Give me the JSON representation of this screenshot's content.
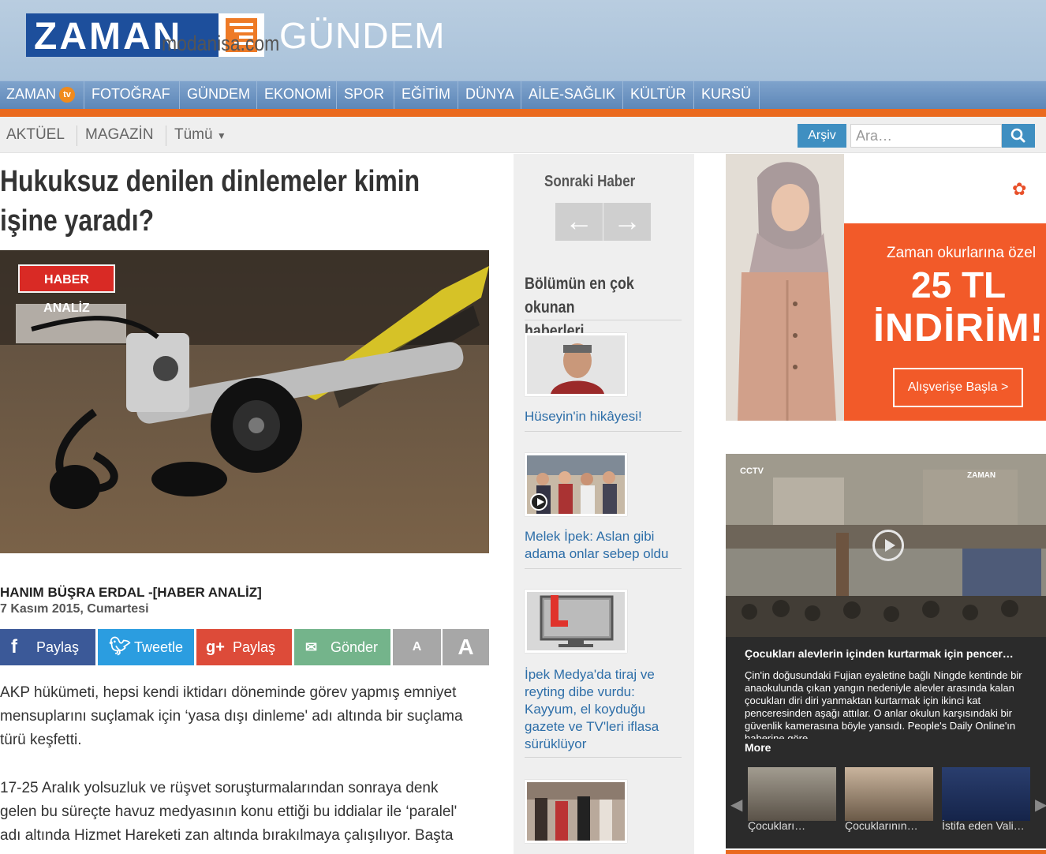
{
  "brand": {
    "logo": "ZAMAN",
    "section": "GÜNDEM"
  },
  "nav": {
    "items": [
      "ZAMAN",
      "FOTOĞRAF",
      "GÜNDEM",
      "EKONOMİ",
      "SPOR",
      "EĞİTİM",
      "DÜNYA",
      "AİLE-SAĞLIK",
      "KÜLTÜR",
      "KURSÜ"
    ],
    "tv_badge": "tv"
  },
  "subnav": {
    "items": [
      "AKTÜEL",
      "MAGAZİN",
      "Tümü"
    ],
    "archive": "Arşiv",
    "search_placeholder": "Ara…"
  },
  "article": {
    "title_line1": "Hukuksuz denilen dinlemeler kimin",
    "title_line2": "işine yaradı?",
    "badge": "HABER ANALİZ",
    "author": "HANIM BÜŞRA ERDAL -[HABER ANALİZ]",
    "date": "7 Kasım 2015, Cumartesi",
    "share": {
      "facebook": "Paylaş",
      "twitter": "Tweetle",
      "google": "Paylaş",
      "email": "Gönder",
      "font_small": "A",
      "font_large": "A"
    },
    "p1": [
      "AKP hükümeti, hepsi kendi iktidarı döneminde görev yapmış emniyet",
      "mensuplarını suçlamak için ‘yasa dışı dinleme' adı altında bir suçlama",
      "türü keşfetti."
    ],
    "p2": [
      "17-25 Aralık yolsuzluk ve rüşvet soruşturmalarından sonraya denk",
      "gelen bu süreçte havuz medyasının konu ettiği bu iddialar ile ‘paralel'",
      "adı altında Hizmet Hareketi zan altında bırakılmaya çalışılıyor. Başta"
    ]
  },
  "sidebar": {
    "next_label": "Sonraki Haber",
    "most_read_title_line1": "Bölümün en çok okunan",
    "most_read_title_line2": "haberleri",
    "items": [
      {
        "lines": [
          "Hüseyin'in hikâyesi!"
        ]
      },
      {
        "lines": [
          "Melek İpek: Aslan gibi",
          "adama onlar sebep oldu"
        ]
      },
      {
        "lines": [
          "İpek Medya'da tiraj ve",
          "reyting dibe vurdu:",
          "Kayyum, el koyduğu",
          "gazete ve TV'leri iflasa",
          "sürüklüyor"
        ]
      }
    ]
  },
  "ad": {
    "brand": "modanisa.com",
    "line1": "Zaman okurlarına özel",
    "amount": "25 TL",
    "discount": "İNDİRİM!",
    "cta": "Alışverişe Başla  >"
  },
  "video": {
    "channel": "CCTV",
    "watermark": "ZAMAN",
    "title": "Çocukları alevlerin içinden kurtarmak için pencer…",
    "description": "Çin'in doğusundaki Fujian eyaletine bağlı Ningde kentinde bir anaokulunda çıkan yangın nedeniyle alevler arasında kalan çocukları diri diri yanmaktan kurtarmak için ikinci kat penceresinden aşağı attılar. O anlar okulun karşısındaki bir güvenlik kamerasına böyle yansıdı. People's Daily Online'ın haberine göre",
    "more": "More",
    "thumbs": [
      "Çocukları…",
      "Çocuklarının…",
      "İstifa eden Vali…"
    ]
  },
  "colors": {
    "brand_blue": "#1d4f9c",
    "accent_orange": "#ea6a1f",
    "link_blue": "#2d6ea8",
    "button_blue": "#3f8fc1"
  }
}
